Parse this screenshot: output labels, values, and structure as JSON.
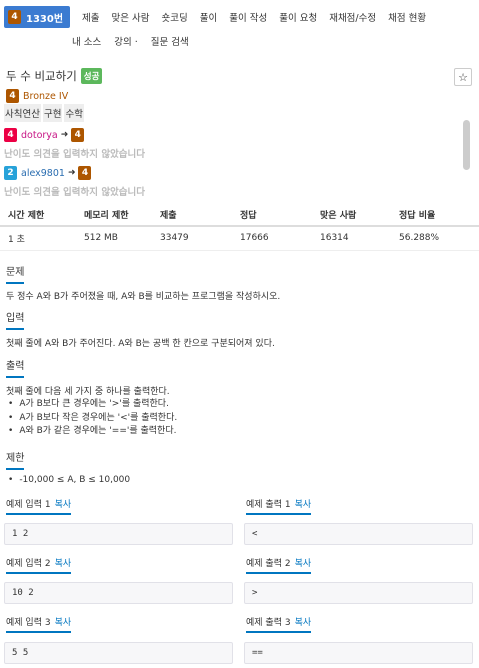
{
  "nav": {
    "problem_tier": "4",
    "problem_number": "1330번",
    "items": [
      "제출",
      "맞은 사람",
      "숏코딩",
      "풀이",
      "풀이 작성",
      "풀이 요청",
      "재채점/수정",
      "채점 현황"
    ],
    "items_row2": [
      "내 소스",
      "강의 ·",
      "질문 검색"
    ]
  },
  "header": {
    "title": "두 수 비교하기",
    "badge": "성공",
    "star": "☆",
    "tier_icon": "4",
    "tier_label": "Bronze IV",
    "tags": [
      "사칙연산",
      "구현",
      "수학"
    ]
  },
  "votes": [
    {
      "from_tier": "4",
      "user": "dotorya",
      "arrow": "➜",
      "to_tier": "4",
      "comment": "난이도 의견을 입력하지 않았습니다"
    },
    {
      "from_tier": "2",
      "user": "alex9801",
      "arrow": "➜",
      "to_tier": "4",
      "comment": "난이도 의견을 입력하지 않았습니다"
    }
  ],
  "info": {
    "headers": [
      "시간 제한",
      "메모리 제한",
      "제출",
      "정답",
      "맞은 사람",
      "정답 비율"
    ],
    "values": [
      "1 초",
      "512 MB",
      "33479",
      "17666",
      "16314",
      "56.288%"
    ]
  },
  "problem": {
    "heading": "문제",
    "text": "두 정수 A와 B가 주어졌을 때, A와 B를 비교하는 프로그램을 작성하시오."
  },
  "input": {
    "heading": "입력",
    "text": "첫째 줄에 A와 B가 주어진다. A와 B는 공백 한 칸으로 구분되어져 있다."
  },
  "output": {
    "heading": "출력",
    "text": "첫째 줄에 다음 세 가지 중 하나를 출력한다.",
    "bullets": [
      "A가 B보다 큰 경우에는 '>'를 출력한다.",
      "A가 B보다 작은 경우에는 '<'를 출력한다.",
      "A와 B가 같은 경우에는 '=='를 출력한다."
    ]
  },
  "limits": {
    "heading": "제한",
    "bullets": [
      "-10,000 ≤ A, B ≤ 10,000"
    ]
  },
  "samples": {
    "copy_label": "복사",
    "pairs": [
      {
        "input_label": "예제 입력 1",
        "output_label": "예제 출력 1",
        "input": "1 2",
        "output": "<"
      },
      {
        "input_label": "예제 입력 2",
        "output_label": "예제 출력 2",
        "input": "10 2",
        "output": ">"
      },
      {
        "input_label": "예제 입력 3",
        "output_label": "예제 출력 3",
        "input": "5 5",
        "output": "=="
      }
    ]
  }
}
